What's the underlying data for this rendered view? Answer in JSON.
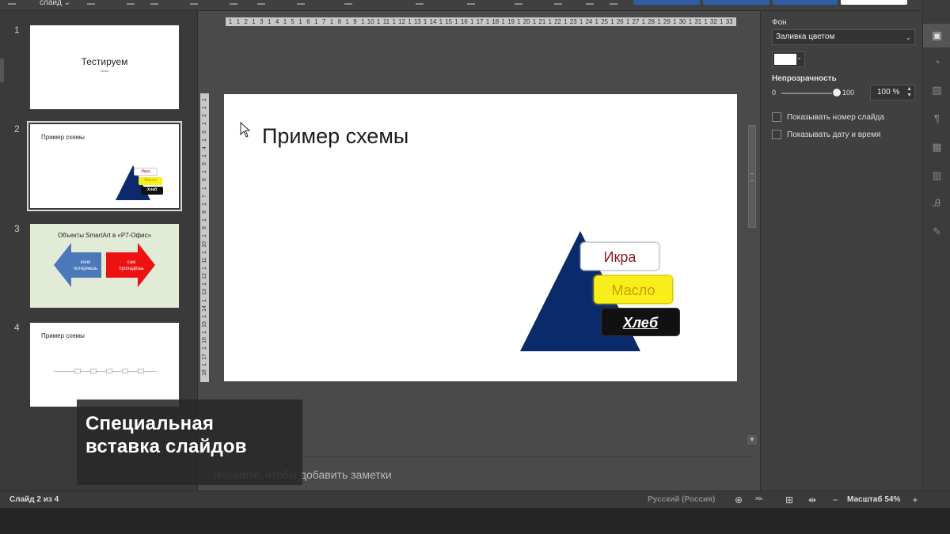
{
  "toolbar": {
    "slide_dropdown": "слайд ⌄"
  },
  "slides": [
    {
      "num": "1",
      "title": "Тестируем",
      "subtitle": "Олан"
    },
    {
      "num": "2",
      "title": "Пример схемы",
      "boxes": [
        "Икра",
        "Масло",
        "Хлеб"
      ]
    },
    {
      "num": "3",
      "title": "Объекты SmartArt в «Р7-Офис»",
      "left_arrow": "коня потеряешь",
      "right_arrow": "сам пропадёшь"
    },
    {
      "num": "4",
      "title": "Пример схемы"
    }
  ],
  "caption": {
    "line1": "Специальная",
    "line2": "вставка слайдов"
  },
  "ruler": {
    "h": [
      "1",
      "1",
      "2",
      "1",
      "3",
      "1",
      "4",
      "1",
      "5",
      "1",
      "6",
      "1",
      "7",
      "1",
      "8",
      "1",
      "9",
      "1",
      "10",
      "1",
      "11",
      "1",
      "12",
      "1",
      "13",
      "1",
      "14",
      "1",
      "15",
      "1",
      "16",
      "1",
      "17",
      "1",
      "18",
      "1",
      "19",
      "1",
      "20",
      "1",
      "21",
      "1",
      "22",
      "1",
      "23",
      "1",
      "24",
      "1",
      "25",
      "1",
      "26",
      "1",
      "27",
      "1",
      "28",
      "1",
      "29",
      "1",
      "30",
      "1",
      "31",
      "1",
      "32",
      "1",
      "33"
    ],
    "v": [
      "1",
      "1",
      "2",
      "1",
      "3",
      "1",
      "4",
      "1",
      "5",
      "1",
      "6",
      "1",
      "7",
      "1",
      "8",
      "1",
      "9",
      "1",
      "10",
      "1",
      "11",
      "1",
      "12",
      "1",
      "13",
      "1",
      "14",
      "1",
      "15",
      "1",
      "16",
      "1",
      "17",
      "1",
      "18"
    ]
  },
  "current_slide": {
    "title": "Пример схемы",
    "pyramid": {
      "items": [
        "Икра",
        "Масло",
        "Хлеб"
      ],
      "triangle_color": "#0b2a6b"
    }
  },
  "notes_placeholder": "Нажмите, чтобы добавить заметки",
  "props": {
    "background_label": "Фон",
    "fill_select": "Заливка цветом",
    "fill_color": "#ffffff",
    "opacity_label": "Непрозрачность",
    "opacity_min": "0",
    "opacity_max": "100",
    "opacity_value": "100 %",
    "show_slide_number": "Показывать номер слайда",
    "show_date_time": "Показывать дату и время"
  },
  "rightbar_icons": [
    "slide-settings-icon",
    "shape-icon",
    "image-icon",
    "paragraph-icon",
    "table-icon",
    "chart-icon",
    "text-art-icon",
    "signature-icon"
  ],
  "status": {
    "slide_of": "Слайд 2 из 4",
    "language": "Русский (Россия)",
    "zoom": "Масштаб 54%"
  }
}
